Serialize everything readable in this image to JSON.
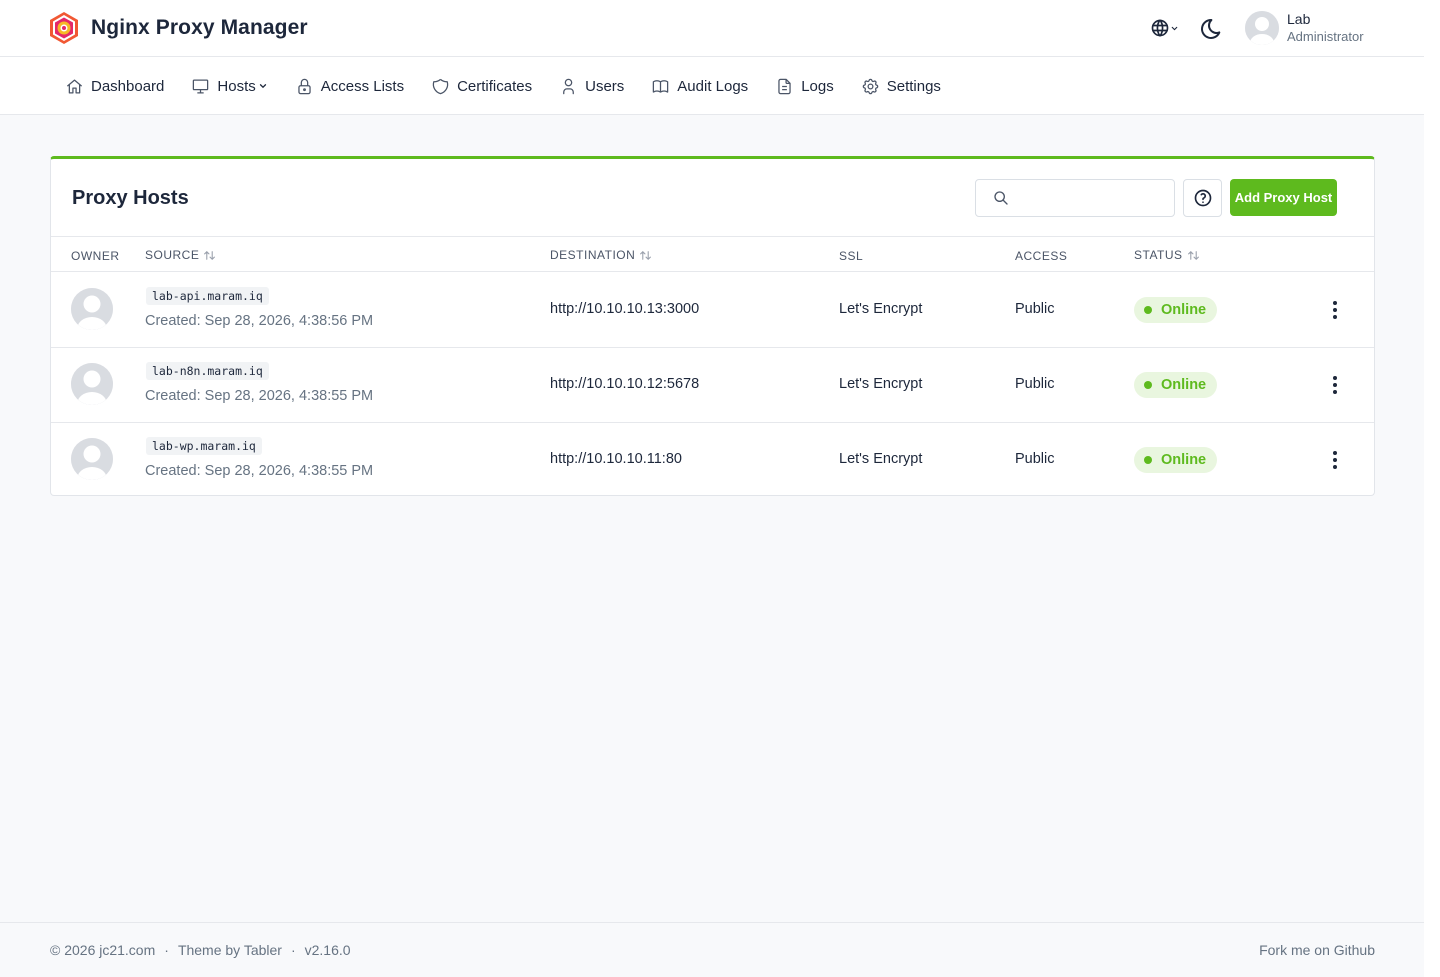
{
  "app": {
    "title": "Nginx Proxy Manager"
  },
  "user": {
    "name": "Lab",
    "role": "Administrator"
  },
  "nav": [
    {
      "label": "Dashboard",
      "icon": "home-icon"
    },
    {
      "label": "Hosts",
      "icon": "monitor-icon",
      "dropdown": true
    },
    {
      "label": "Access Lists",
      "icon": "lock-icon"
    },
    {
      "label": "Certificates",
      "icon": "shield-icon"
    },
    {
      "label": "Users",
      "icon": "user-icon"
    },
    {
      "label": "Audit Logs",
      "icon": "book-icon"
    },
    {
      "label": "Logs",
      "icon": "file-icon"
    },
    {
      "label": "Settings",
      "icon": "gear-icon"
    }
  ],
  "card": {
    "title": "Proxy Hosts",
    "search_placeholder": "",
    "add_button": "Add Proxy Host"
  },
  "table": {
    "headers": {
      "owner": "OWNER",
      "source": "SOURCE",
      "destination": "DESTINATION",
      "ssl": "SSL",
      "access": "ACCESS",
      "status": "STATUS"
    },
    "rows": [
      {
        "domain": "lab-api.maram.iq",
        "created": "Created: Sep 28, 2026, 4:38:56 PM",
        "destination": "http://10.10.10.13:3000",
        "ssl": "Let's Encrypt",
        "access": "Public",
        "status": "Online"
      },
      {
        "domain": "lab-n8n.maram.iq",
        "created": "Created: Sep 28, 2026, 4:38:55 PM",
        "destination": "http://10.10.10.12:5678",
        "ssl": "Let's Encrypt",
        "access": "Public",
        "status": "Online"
      },
      {
        "domain": "lab-wp.maram.iq",
        "created": "Created: Sep 28, 2026, 4:38:55 PM",
        "destination": "http://10.10.10.11:80",
        "ssl": "Let's Encrypt",
        "access": "Public",
        "status": "Online"
      }
    ]
  },
  "footer": {
    "copyright": "© 2026 jc21.com",
    "theme": "Theme by Tabler",
    "version": "v2.16.0",
    "github": "Fork me on Github"
  },
  "colors": {
    "accent": "#5eba1e",
    "status_bg": "#e9f6df"
  }
}
